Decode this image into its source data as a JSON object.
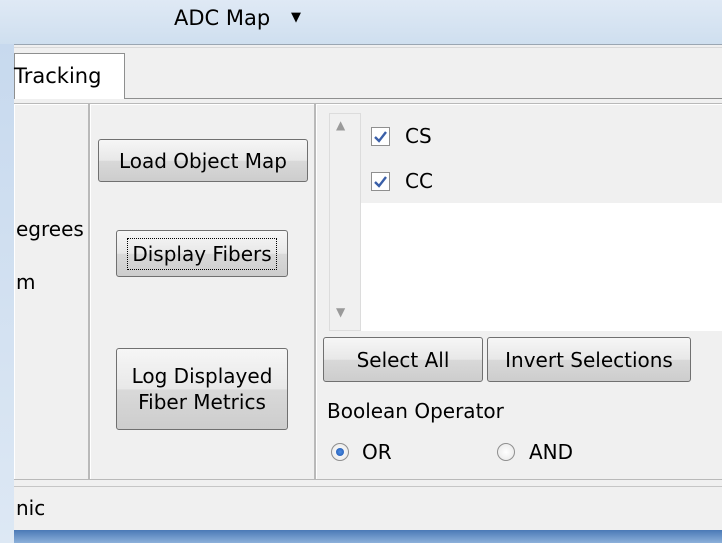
{
  "header": {
    "map_dropdown_label": "ADC Map",
    "map_dropdown_icon": "chevron-down-icon"
  },
  "tabs": [
    {
      "label": "Tracking",
      "active": true
    }
  ],
  "left_panel": {
    "labels": [
      "egrees",
      "m"
    ]
  },
  "middle_panel": {
    "load_button": "Load Object Map",
    "display_button": "Display Fibers",
    "log_button_line1": "Log Displayed",
    "log_button_line2": "Fiber Metrics"
  },
  "objects_list": {
    "items": [
      {
        "label": "CS",
        "checked": true
      },
      {
        "label": "CC",
        "checked": true
      }
    ]
  },
  "selection_buttons": {
    "select_all": "Select All",
    "invert": "Invert Selections"
  },
  "boolean_operator": {
    "label": "Boolean Operator",
    "options": [
      {
        "label": "OR",
        "selected": true
      },
      {
        "label": "AND",
        "selected": false
      }
    ]
  },
  "status_bar": {
    "text": "nic"
  },
  "colors": {
    "checkmark": "#3a5fa8",
    "window_frame": "#d7e4f2",
    "radio_selected": "#1c55b0"
  }
}
